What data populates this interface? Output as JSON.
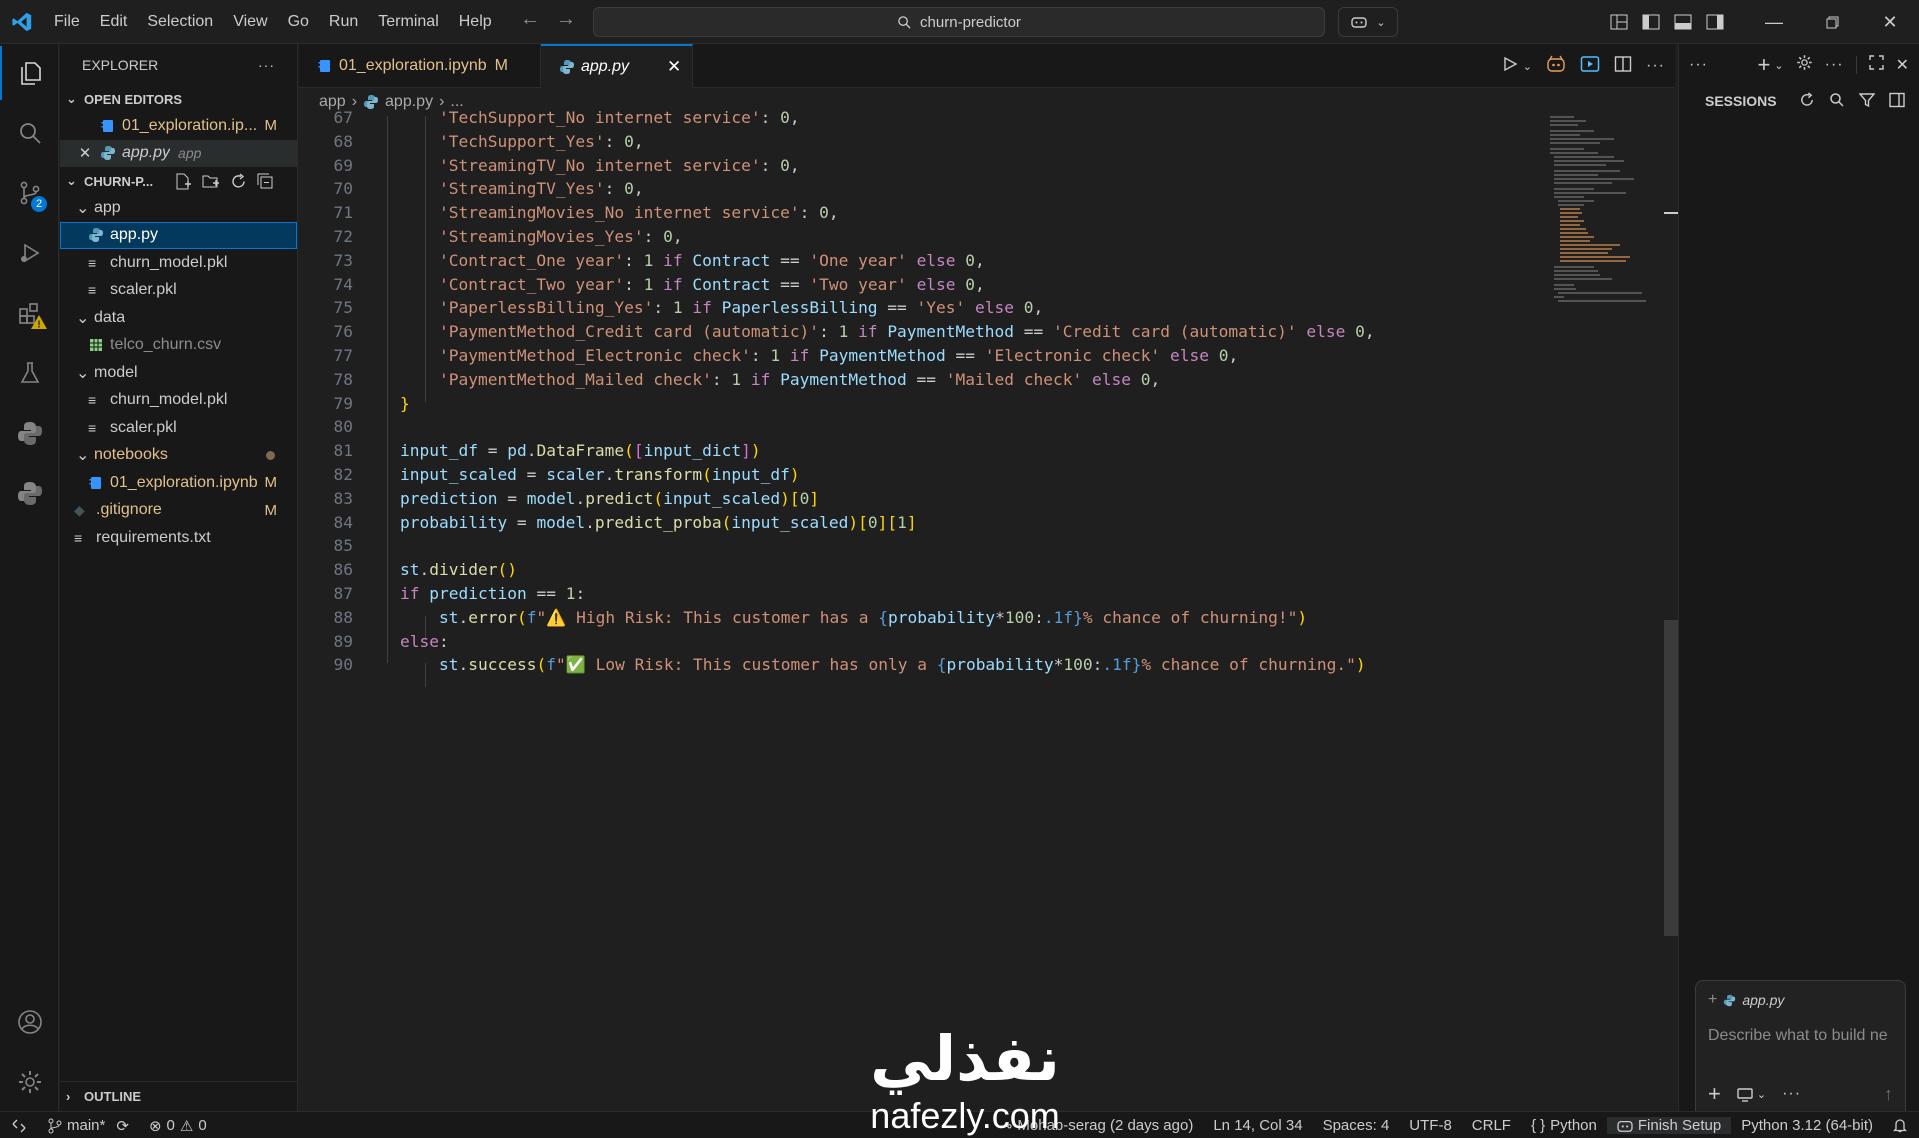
{
  "menu": [
    "File",
    "Edit",
    "Selection",
    "View",
    "Go",
    "Run",
    "Terminal",
    "Help"
  ],
  "command_center": "churn-predictor",
  "explorer": {
    "title": "EXPLORER",
    "open_editors_label": "OPEN EDITORS",
    "open_editors": [
      {
        "name": "01_exploration.ip...",
        "mark": "M"
      },
      {
        "name": "app.py",
        "hint": "app"
      }
    ],
    "workspace_label": "CHURN-P...",
    "tree": {
      "app_folder": "app",
      "app_py": "app.py",
      "app_model": "churn_model.pkl",
      "app_scaler": "scaler.pkl",
      "data_folder": "data",
      "data_csv": "telco_churn.csv",
      "model_folder": "model",
      "model_model": "churn_model.pkl",
      "model_scaler": "scaler.pkl",
      "notebooks_folder": "notebooks",
      "nb_file": "01_exploration.ipynb",
      "nb_mark": "M",
      "gitignore": ".gitignore",
      "gitignore_mark": "M",
      "requirements": "requirements.txt"
    },
    "outline_label": "OUTLINE"
  },
  "activity_badge": "2",
  "tabs": [
    {
      "label": "01_exploration.ipynb",
      "mark": "M"
    },
    {
      "label": "app.py"
    }
  ],
  "breadcrumb": {
    "folder": "app",
    "file": "app.py",
    "more": "..."
  },
  "code_lines": [
    {
      "n": "67",
      "t": "        'TechSupport_No internet service': 0,"
    },
    {
      "n": "68",
      "t": "        'TechSupport_Yes': 0,"
    },
    {
      "n": "69",
      "t": "        'StreamingTV_No internet service': 0,"
    },
    {
      "n": "70",
      "t": "        'StreamingTV_Yes': 0,"
    },
    {
      "n": "71",
      "t": "        'StreamingMovies_No internet service': 0,"
    },
    {
      "n": "72",
      "t": "        'StreamingMovies_Yes': 0,"
    },
    {
      "n": "73",
      "t": "        'Contract_One year': 1 if Contract == 'One year' else 0,"
    },
    {
      "n": "74",
      "t": "        'Contract_Two year': 1 if Contract == 'Two year' else 0,"
    },
    {
      "n": "75",
      "t": "        'PaperlessBilling_Yes': 1 if PaperlessBilling == 'Yes' else 0,"
    },
    {
      "n": "76",
      "t": "        'PaymentMethod_Credit card (automatic)': 1 if PaymentMethod == 'Credit card (automatic)' else 0,"
    },
    {
      "n": "77",
      "t": "        'PaymentMethod_Electronic check': 1 if PaymentMethod == 'Electronic check' else 0,"
    },
    {
      "n": "78",
      "t": "        'PaymentMethod_Mailed check': 1 if PaymentMethod == 'Mailed check' else 0,"
    },
    {
      "n": "79",
      "t": "    }"
    },
    {
      "n": "80",
      "t": ""
    },
    {
      "n": "81",
      "t": "    input_df = pd.DataFrame([input_dict])"
    },
    {
      "n": "82",
      "t": "    input_scaled = scaler.transform(input_df)"
    },
    {
      "n": "83",
      "t": "    prediction = model.predict(input_scaled)[0]"
    },
    {
      "n": "84",
      "t": "    probability = model.predict_proba(input_scaled)[0][1]"
    },
    {
      "n": "85",
      "t": ""
    },
    {
      "n": "86",
      "t": "    st.divider()"
    },
    {
      "n": "87",
      "t": "    if prediction == 1:"
    },
    {
      "n": "88",
      "t": "        st.error(f\"⚠️ High Risk: This customer has a {probability*100:.1f}% chance of churning!\")"
    },
    {
      "n": "89",
      "t": "    else:"
    },
    {
      "n": "90",
      "t": "        st.success(f\"✅ Low Risk: This customer has only a {probability*100:.1f}% chance of churning.\")"
    }
  ],
  "right_panel": {
    "sessions_label": "SESSIONS",
    "chip_label": "app.py",
    "chat_placeholder": "Describe what to build ne"
  },
  "status": {
    "branch": "main*",
    "errors": "0",
    "warnings": "0",
    "blame": "Mohab-serag (2 days ago)",
    "position": "Ln 14, Col 34",
    "spaces": "Spaces: 4",
    "encoding": "UTF-8",
    "eol": "CRLF",
    "lang_braces": "{ }",
    "language": "Python",
    "finish_setup": "Finish Setup",
    "interpreter": "Python 3.12 (64-bit)"
  },
  "watermark": {
    "arabic": "نفذلي",
    "latin": "nafezly.com"
  },
  "colors": {
    "accent": "#0078d4",
    "modified": "#e2c08d",
    "string": "#ce9178",
    "keyword": "#c586c0",
    "variable": "#9cdcfe",
    "function": "#dcdcaa",
    "number": "#b5cea8",
    "class": "#4ec9b0"
  }
}
